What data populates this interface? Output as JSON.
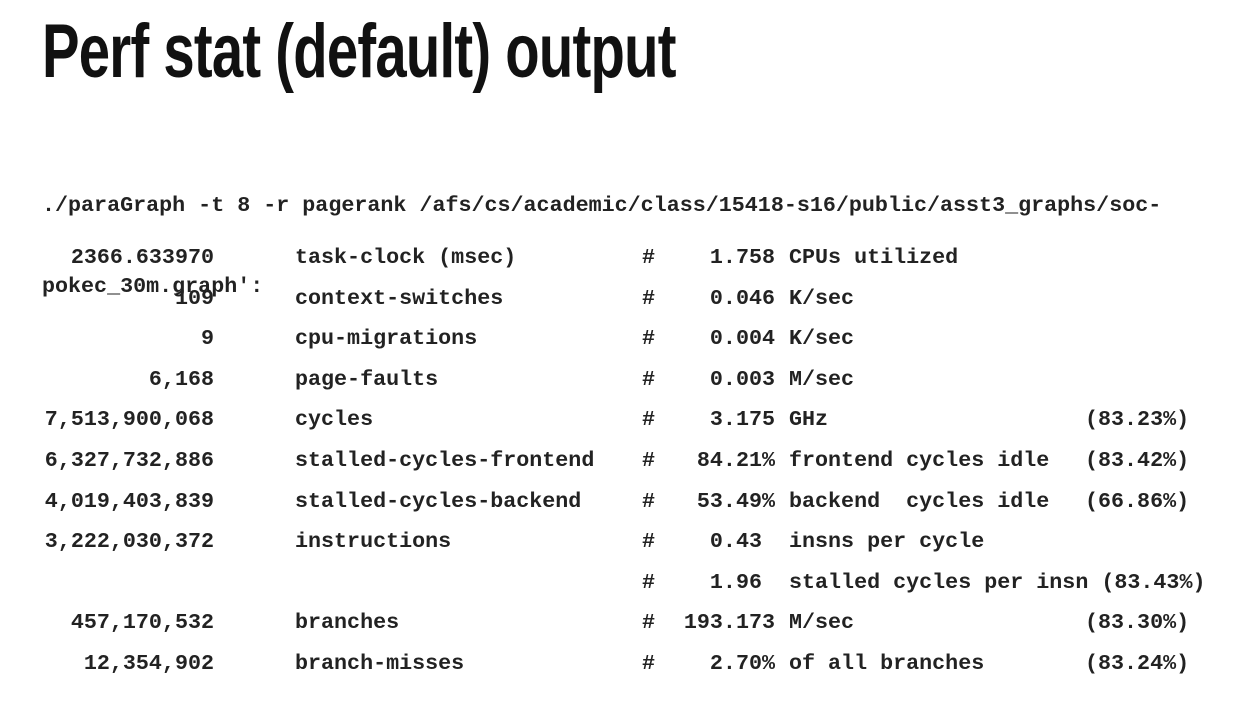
{
  "title": "Perf stat (default) output",
  "command": {
    "line1": "./paraGraph -t 8 -r pagerank /afs/cs/academic/class/15418-s16/public/asst3_graphs/soc-",
    "line2": "pokec_30m.graph':"
  },
  "rows": [
    {
      "count": "2366.633970",
      "event": "task-clock (msec)",
      "hash": "#",
      "value": "1.758",
      "desc": "CPUs utilized",
      "pct": ""
    },
    {
      "count": "109",
      "event": "context-switches",
      "hash": "#",
      "value": "0.046",
      "desc": "K/sec",
      "pct": ""
    },
    {
      "count": "9",
      "event": "cpu-migrations",
      "hash": "#",
      "value": "0.004",
      "desc": "K/sec",
      "pct": ""
    },
    {
      "count": "6,168",
      "event": "page-faults",
      "hash": "#",
      "value": "0.003",
      "desc": "M/sec",
      "pct": ""
    },
    {
      "count": "7,513,900,068",
      "event": "cycles",
      "hash": "#",
      "value": "3.175",
      "desc": "GHz",
      "pct": "(83.23%)"
    },
    {
      "count": "6,327,732,886",
      "event": "stalled-cycles-frontend",
      "hash": "#",
      "value": "84.21%",
      "desc": "frontend cycles idle",
      "pct": "(83.42%)"
    },
    {
      "count": "4,019,403,839",
      "event": "stalled-cycles-backend",
      "hash": "#",
      "value": "53.49%",
      "desc": "backend  cycles idle",
      "pct": "(66.86%)"
    },
    {
      "count": "3,222,030,372",
      "event": "instructions",
      "hash": "#",
      "value": "0.43 ",
      "desc": "insns per cycle",
      "pct": ""
    },
    {
      "count": "",
      "event": "",
      "hash": "#",
      "value": "1.96 ",
      "desc": "stalled cycles per insn (83.43%)",
      "pct": ""
    },
    {
      "count": "457,170,532",
      "event": "branches",
      "hash": "#",
      "value": "193.173",
      "desc": "M/sec",
      "pct": "(83.30%)"
    },
    {
      "count": "12,354,902",
      "event": "branch-misses",
      "hash": "#",
      "value": "2.70%",
      "desc": "of all branches",
      "pct": "(83.24%)"
    }
  ]
}
